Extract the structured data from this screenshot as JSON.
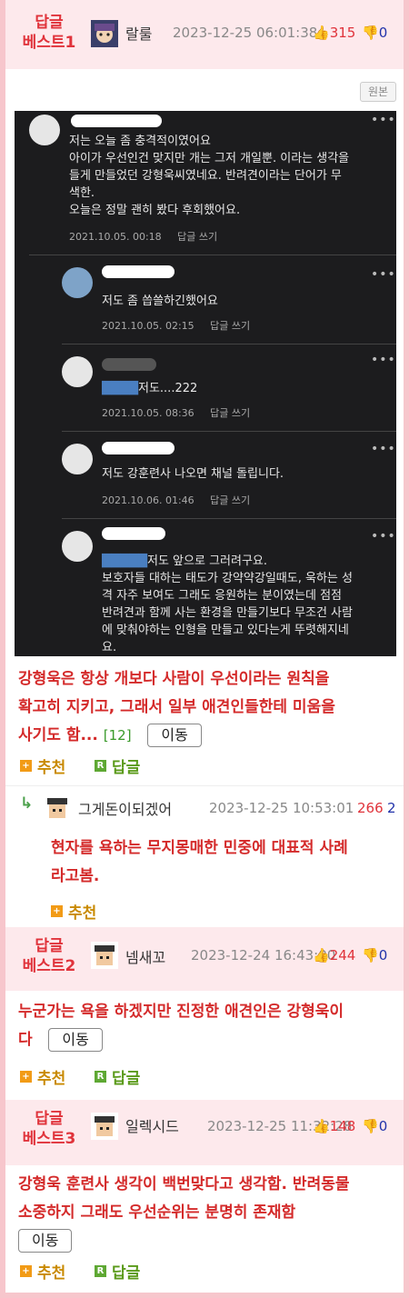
{
  "best1": {
    "label_line1": "답글",
    "label_line2": "베스트1",
    "nick": "랄룰",
    "date": "2023-12-25 06:01:38",
    "up": "315",
    "down": "0",
    "original_btn": "원본",
    "screenshot": {
      "comments": [
        {
          "lines": [
            "저는 오늘 좀 충격적이였어요",
            "아이가 우선인건 맞지만 개는 그저 개일뿐. 이라는 생각을",
            "들게 만들었던 강형욱씨였네요. 반려견이라는 단어가 무",
            "색한.",
            "오늘은 정말 괜히 봤다 후회했어요."
          ],
          "meta": "2021.10.05. 00:18",
          "reply": "답글 쓰기"
        },
        {
          "lines": [
            "저도 좀 씁쓸하긴했어요"
          ],
          "meta": "2021.10.05. 02:15",
          "reply": "답글 쓰기"
        },
        {
          "lines": [
            "저도....222"
          ],
          "meta": "2021.10.05. 08:36",
          "reply": "답글 쓰기"
        },
        {
          "lines": [
            "저도 강훈련사 나오면 채널 돌립니다."
          ],
          "meta": "2021.10.06. 01:46",
          "reply": "답글 쓰기"
        },
        {
          "lines": [
            "저도 앞으로 그러려구요.",
            "보호자들 대하는 태도가 강약약강일때도, 욱하는 성",
            "격 자주 보여도 그래도 응원하는 분이였는데 점점",
            "반려견과 함께 사는 환경을 만들기보다 무조건 사람",
            "에 맞춰야하는 인형을 만들고 있다는게 뚜렷해지네",
            "요."
          ]
        }
      ],
      "dots": "•••"
    },
    "text_line1": "강형욱은 항상 개보다 사람이 우선이라는 원칙을",
    "text_line2": "확고히 지키고, 그래서 일부 애견인들한테 미움을",
    "text_line3": "사기도 함...",
    "count": "[12]",
    "move_btn": "이동",
    "recommend": "추천",
    "reply": "답글"
  },
  "sub_reply": {
    "arrow": "↳",
    "nick": "그게돈이되겠어",
    "date": "2023-12-25 10:53:01",
    "up": "266",
    "down": "2",
    "text_line1": "현자를 욕하는 무지몽매한 민중에 대표적 사례",
    "text_line2": "라고봄.",
    "recommend": "추천"
  },
  "best2": {
    "label_line1": "답글",
    "label_line2": "베스트2",
    "nick": "넴새꼬",
    "date": "2023-12-24 16:43:00",
    "up": "244",
    "down": "0",
    "text_line1": "누군가는 욕을 하겠지만 진정한 애견인은 강형욱이",
    "text_line2": "다",
    "move_btn": "이동",
    "recommend": "추천",
    "reply": "답글"
  },
  "best3": {
    "label_line1": "답글",
    "label_line2": "베스트3",
    "nick": "일렉시드",
    "date": "2023-12-25 11:32:28",
    "up": "148",
    "down": "0",
    "text_line1": "강형욱 훈련사 생각이 백번맞다고 생각함. 반려동물",
    "text_line2": "소중하지 그래도 우선순위는 분명히 존재함",
    "move_btn": "이동",
    "recommend": "추천",
    "reply": "답글"
  }
}
